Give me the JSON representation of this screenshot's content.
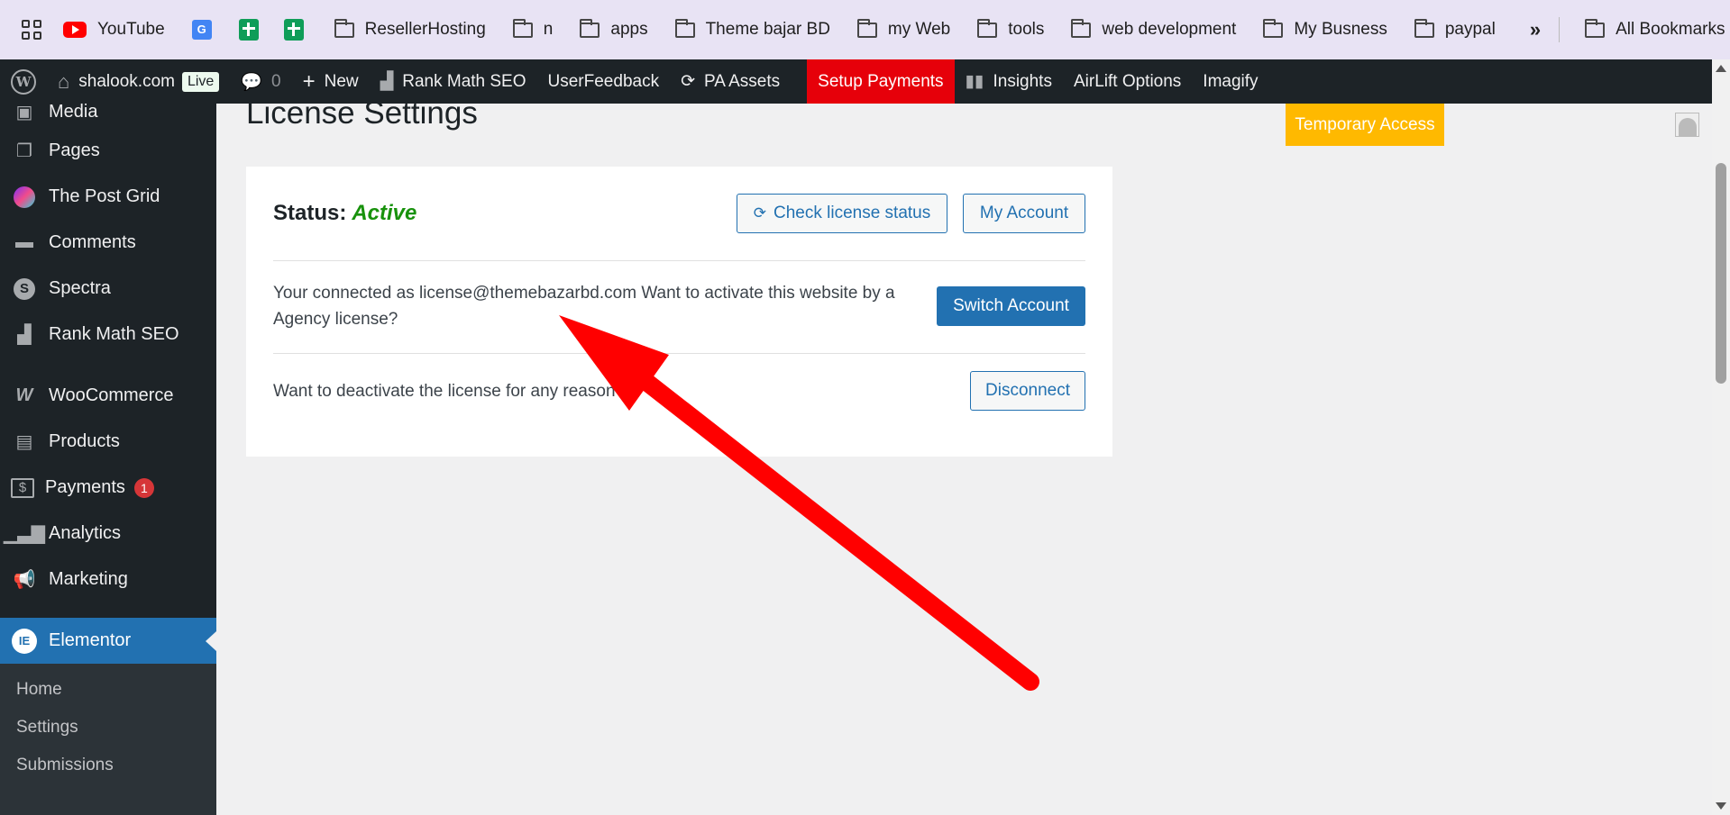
{
  "bookmarks": {
    "items": [
      "YouTube",
      "ResellerHosting",
      "n",
      "apps",
      "Theme bajar BD",
      "my Web",
      "tools",
      "web development",
      "My Busness",
      "paypal"
    ],
    "all_bookmarks": "All Bookmarks"
  },
  "adminbar": {
    "site_name": "shalook.com",
    "live_label": "Live",
    "comments_count": "0",
    "new_label": "New",
    "rank_math": "Rank Math SEO",
    "user_feedback": "UserFeedback",
    "pa_assets": "PA Assets",
    "setup_payments": "Setup Payments",
    "insights": "Insights",
    "airlift": "AirLift Options",
    "imagify": "Imagify"
  },
  "sidebar": {
    "items": [
      {
        "label": "Media"
      },
      {
        "label": "Pages"
      },
      {
        "label": "The Post Grid"
      },
      {
        "label": "Comments"
      },
      {
        "label": "Spectra"
      },
      {
        "label": "Rank Math SEO"
      },
      {
        "label": "WooCommerce"
      },
      {
        "label": "Products"
      },
      {
        "label": "Payments",
        "badge": "1"
      },
      {
        "label": "Analytics"
      },
      {
        "label": "Marketing"
      },
      {
        "label": "Elementor"
      }
    ],
    "submenu": [
      "Home",
      "Settings",
      "Submissions"
    ]
  },
  "main": {
    "page_title": "License Settings",
    "temporary_access": "Temporary Access",
    "status_label": "Status:",
    "status_value": "Active",
    "check_license_button": "Check license status",
    "my_account_button": "My Account",
    "connected_text_line1": "Your connected as license@themebazarbd.com Want to activate this website by a",
    "connected_text_line2": "Agency license?",
    "switch_account_button": "Switch Account",
    "deactivate_text": "Want to deactivate the license for any reason?",
    "disconnect_button": "Disconnect"
  },
  "colors": {
    "admin_bg": "#1d2327",
    "accent_blue": "#2271b1",
    "status_green": "#18920c",
    "setup_payments_red": "#e6000a",
    "temporary_access_yellow": "#ffb900",
    "annotation_arrow": "#ff0000"
  }
}
